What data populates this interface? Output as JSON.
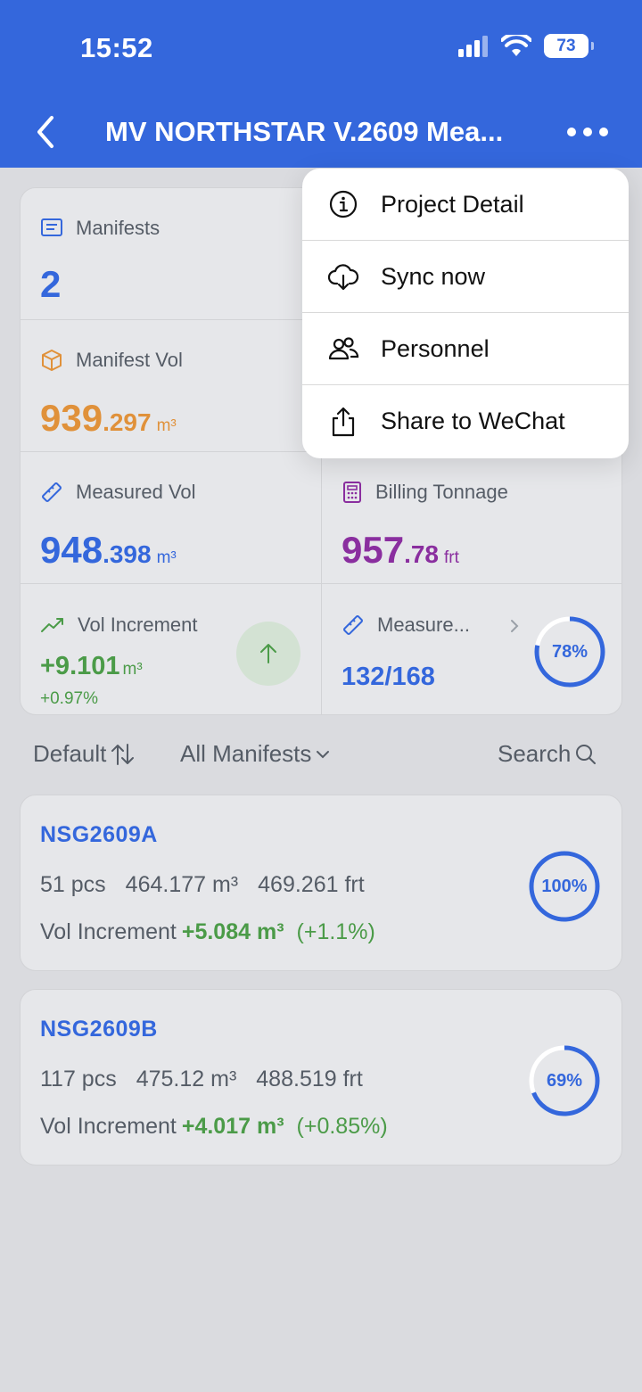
{
  "status": {
    "time": "15:52",
    "battery": "73"
  },
  "nav": {
    "title": "MV NORTHSTAR V.2609 Mea..."
  },
  "stats": {
    "manifests": {
      "label": "Manifests",
      "value": "2"
    },
    "manifest_vol": {
      "label": "Manifest Vol",
      "int": "939",
      "dec": ".297",
      "unit": "m³"
    },
    "measured_vol": {
      "label": "Measured Vol",
      "int": "948",
      "dec": ".398",
      "unit": "m³"
    },
    "billing_tonnage": {
      "label": "Billing Tonnage",
      "int": "957",
      "dec": ".78",
      "unit": "frt"
    },
    "vol_increment": {
      "label": "Vol Increment",
      "value": "+9.101",
      "unit": "m³",
      "pct": "+0.97%"
    },
    "measure_progress": {
      "label": "Measure...",
      "value": "132/168",
      "percent_label": "78%",
      "fraction": 0.78
    }
  },
  "filters": {
    "sort": "Default",
    "scope": "All Manifests",
    "search": "Search"
  },
  "manifests": [
    {
      "code": "NSG2609A",
      "pcs": "51 pcs",
      "vol": "464.177 m³",
      "frt": "469.261 frt",
      "inc_label": "Vol Increment",
      "inc": "+5.084 m³",
      "inc_pct": "(+1.1%)",
      "percent_label": "100%",
      "fraction": 1.0
    },
    {
      "code": "NSG2609B",
      "pcs": "117 pcs",
      "vol": "475.12 m³",
      "frt": "488.519 frt",
      "inc_label": "Vol Increment",
      "inc": "+4.017 m³",
      "inc_pct": "(+0.85%)",
      "percent_label": "69%",
      "fraction": 0.69
    }
  ],
  "menu": {
    "items": [
      {
        "label": "Project Detail",
        "icon": "info-icon"
      },
      {
        "label": "Sync now",
        "icon": "cloud-download-icon"
      },
      {
        "label": "Personnel",
        "icon": "people-icon"
      },
      {
        "label": "Share to WeChat",
        "icon": "share-icon"
      }
    ]
  },
  "colors": {
    "brand": "#3467dc",
    "orange": "#e0913a",
    "purple": "#8a2e9f",
    "green": "#4b9b48"
  }
}
